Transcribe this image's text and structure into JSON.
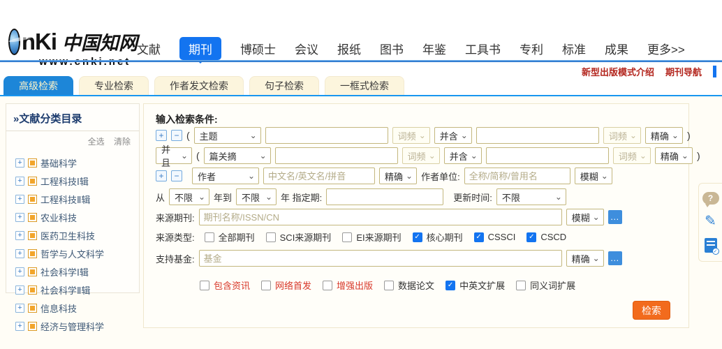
{
  "colors": {
    "accent_blue": "#1374f0",
    "tab_blue": "#1d86d8",
    "button_orange": "#f26b1d",
    "link_red": "#b3261e"
  },
  "icons": {
    "plus": "+",
    "minus": "−",
    "chevron": "⌄",
    "ellipsis": "…",
    "check": "✓",
    "help": "?",
    "pencil": "✎",
    "double_arrow": "»"
  },
  "logo": {
    "text": "nKi",
    "chinese": "中国知网",
    "url": "www.cnki.net"
  },
  "header": {
    "nav": [
      "文献",
      "期刊",
      "博硕士",
      "会议",
      "报纸",
      "图书",
      "年鉴",
      "工具书",
      "专利",
      "标准",
      "成果",
      "更多>>"
    ],
    "links": [
      "新型出版模式介绍",
      "期刊导航"
    ]
  },
  "tabs": [
    "高级检索",
    "专业检索",
    "作者发文检索",
    "句子检索",
    "一框式检索"
  ],
  "sidebar": {
    "title": "文献分类目录",
    "select_all": "全选",
    "clear": "清除",
    "items": [
      "基础科学",
      "工程科技Ⅰ辑",
      "工程科技Ⅱ辑",
      "农业科技",
      "医药卫生科技",
      "哲学与人文科学",
      "社会科学Ⅰ辑",
      "社会科学Ⅱ辑",
      "信息科技",
      "经济与管理科学"
    ]
  },
  "form": {
    "title": "输入检索条件:",
    "open_paren": "(",
    "close_paren": ")",
    "fields": {
      "row1": "主题",
      "row2": "篇关摘",
      "row3": "作者"
    },
    "ops": {
      "and": "并且",
      "contain": "并含"
    },
    "freq": "词频",
    "exact": "精确",
    "fuzzy": "模糊",
    "unlimited": "不限",
    "row3": {
      "author_ph": "中文名/英文名/拼音",
      "unit_label": "作者单位:",
      "unit_ph": "全称/简称/曾用名"
    },
    "row4": {
      "from": "从",
      "to": "年到",
      "issue": "年 指定期:",
      "update": "更新时间:"
    },
    "row5": {
      "label": "来源期刊:",
      "ph": "期刊名称/ISSN/CN"
    },
    "row6": {
      "label": "来源类型:",
      "options": [
        "全部期刊",
        "SCI来源期刊",
        "EI来源期刊",
        "核心期刊",
        "CSSCI",
        "CSCD"
      ]
    },
    "row7": {
      "label": "支持基金:",
      "ph": "基金"
    },
    "row8": {
      "options": [
        "包含资讯",
        "网络首发",
        "增强出版",
        "数据论文",
        "中英文扩展",
        "同义词扩展"
      ]
    },
    "search_button": "检索"
  }
}
